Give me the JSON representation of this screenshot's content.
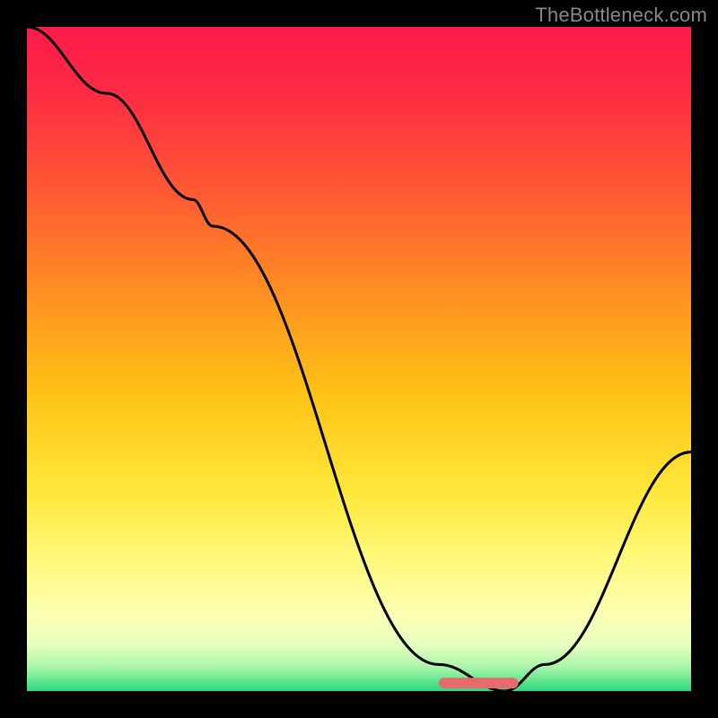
{
  "watermark": "TheBottleneck.com",
  "chart_data": {
    "type": "line",
    "title": "",
    "xlabel": "",
    "ylabel": "",
    "xlim": [
      0,
      100
    ],
    "ylim": [
      0,
      100
    ],
    "gradient_stops": [
      {
        "offset": 0.0,
        "color": "#ff1a4a"
      },
      {
        "offset": 0.1,
        "color": "#ff2b44"
      },
      {
        "offset": 0.25,
        "color": "#ff5a33"
      },
      {
        "offset": 0.4,
        "color": "#ff8f22"
      },
      {
        "offset": 0.55,
        "color": "#ffc215"
      },
      {
        "offset": 0.7,
        "color": "#ffe83a"
      },
      {
        "offset": 0.8,
        "color": "#fff87a"
      },
      {
        "offset": 0.88,
        "color": "#fdffb0"
      },
      {
        "offset": 0.93,
        "color": "#e7ffc0"
      },
      {
        "offset": 0.965,
        "color": "#a8f5a8"
      },
      {
        "offset": 1.0,
        "color": "#2bd97e"
      }
    ],
    "series": [
      {
        "name": "bottleneck-curve",
        "x": [
          0,
          12,
          25,
          28,
          62,
          72,
          78,
          100
        ],
        "values": [
          100,
          90,
          74,
          70,
          4,
          0,
          4,
          36
        ]
      }
    ],
    "marker": {
      "name": "optimal-range",
      "x_start": 62,
      "x_end": 74,
      "y": 1.2,
      "color": "#e86b6b"
    }
  }
}
